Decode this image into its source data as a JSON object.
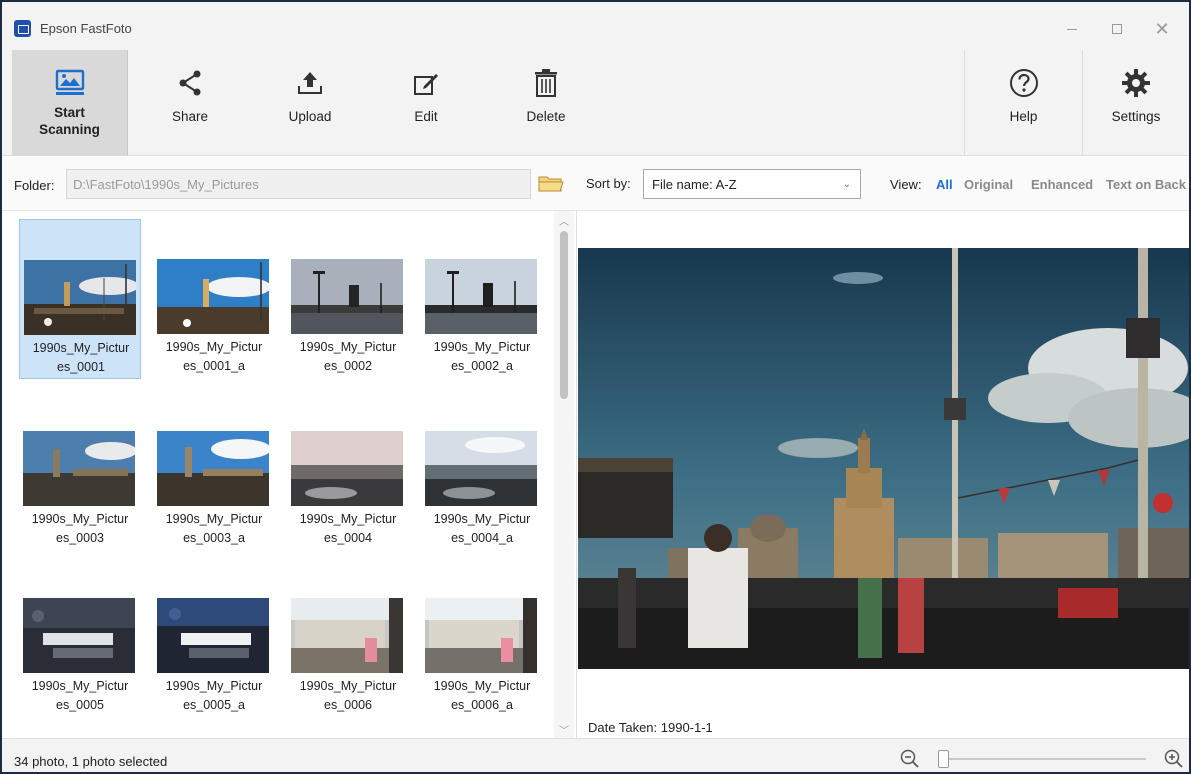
{
  "window": {
    "title": "Epson FastFoto"
  },
  "toolbar": {
    "start_scanning": "Start\nScanning",
    "share": "Share",
    "upload": "Upload",
    "edit": "Edit",
    "delete": "Delete",
    "help": "Help",
    "settings": "Settings"
  },
  "folder": {
    "label": "Folder:",
    "path": "D:\\FastFoto\\1990s_My_Pictures"
  },
  "sort": {
    "label": "Sort by:",
    "value": "File name: A-Z"
  },
  "view": {
    "label": "View:",
    "options": [
      "All",
      "Original",
      "Enhanced",
      "Text on Back"
    ],
    "active": "All"
  },
  "thumbnails": [
    {
      "name": "1990s_My_Pictur\nes_0001",
      "selected": true
    },
    {
      "name": "1990s_My_Pictur\nes_0001_a"
    },
    {
      "name": "1990s_My_Pictur\nes_0002"
    },
    {
      "name": "1990s_My_Pictur\nes_0002_a"
    },
    {
      "name": "1990s_My_Pictur\nes_0003"
    },
    {
      "name": "1990s_My_Pictur\nes_0003_a"
    },
    {
      "name": "1990s_My_Pictur\nes_0004"
    },
    {
      "name": "1990s_My_Pictur\nes_0004_a"
    },
    {
      "name": "1990s_My_Pictur\nes_0005"
    },
    {
      "name": "1990s_My_Pictur\nes_0005_a"
    },
    {
      "name": "1990s_My_Pictur\nes_0006"
    },
    {
      "name": "1990s_My_Pictur\nes_0006_a"
    }
  ],
  "preview": {
    "date_taken": "Date Taken: 1990-1-1"
  },
  "status": {
    "text": "34 photo, 1 photo selected"
  },
  "colors": {
    "accent": "#1f6fd0",
    "selection": "#cde4f8",
    "toolbar_bg": "#f3f3f3"
  }
}
